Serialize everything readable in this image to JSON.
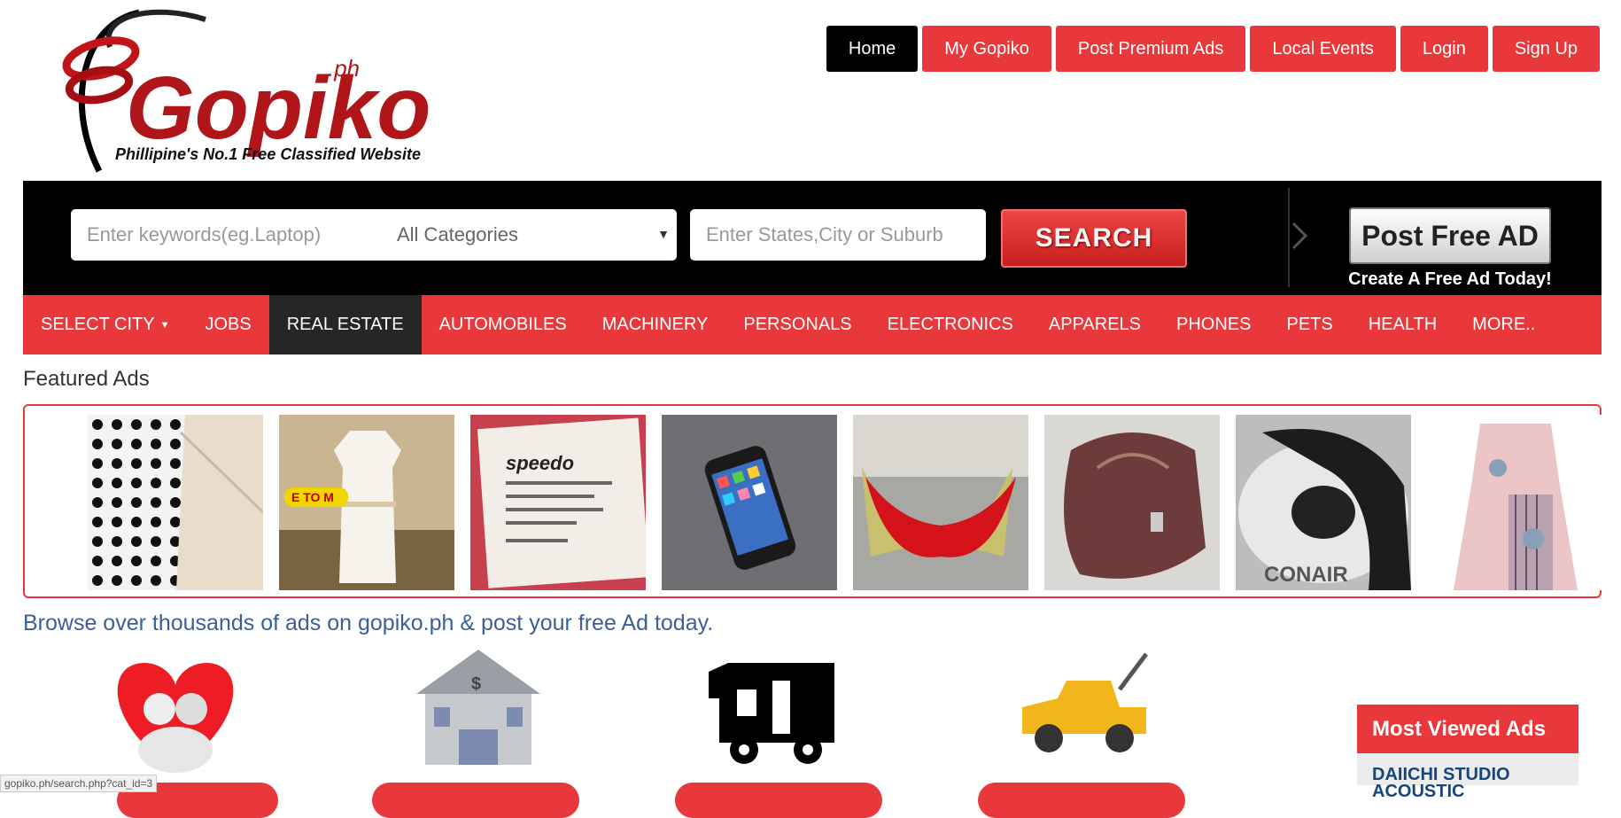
{
  "logo": {
    "brand": "Gopiko",
    "suffix": ".ph",
    "tagline": "Phillipine's No.1  Free Classified Website"
  },
  "top_nav": [
    {
      "label": "Home",
      "active": true
    },
    {
      "label": "My Gopiko"
    },
    {
      "label": "Post Premium Ads"
    },
    {
      "label": "Local Events"
    },
    {
      "label": "Login"
    },
    {
      "label": "Sign Up"
    }
  ],
  "search": {
    "keywords_placeholder": "Enter keywords(eg.Laptop)",
    "category_value": "All Categories",
    "location_placeholder": "Enter States,City or Suburb",
    "button_label": "SEARCH"
  },
  "post_free": {
    "button_label": "Post Free AD",
    "sub_label": "Create A Free Ad Today!"
  },
  "categories": [
    {
      "label": "SELECT CITY"
    },
    {
      "label": "JOBS"
    },
    {
      "label": "REAL ESTATE",
      "active": true
    },
    {
      "label": "AUTOMOBILES"
    },
    {
      "label": "MACHINERY"
    },
    {
      "label": "PERSONALS"
    },
    {
      "label": "ELECTRONICS"
    },
    {
      "label": "APPARELS"
    },
    {
      "label": "PHONES"
    },
    {
      "label": "PETS"
    },
    {
      "label": "HEALTH"
    },
    {
      "label": "MORE.."
    }
  ],
  "featured": {
    "title": "Featured Ads",
    "items": [
      {
        "name": "polka-dot-fabric"
      },
      {
        "name": "white-dress",
        "label": "E TO M"
      },
      {
        "name": "speedo-swimsuit-tag",
        "brand": "speedo"
      },
      {
        "name": "smartphone"
      },
      {
        "name": "red-high-heels"
      },
      {
        "name": "leather-handbag"
      },
      {
        "name": "conair-appliance",
        "brand": "CONAIR"
      },
      {
        "name": "floral-dress"
      }
    ]
  },
  "browse_text": "Browse over thousands of ads on gopiko.ph & post your free Ad today.",
  "category_icons": [
    "personals-heart-icon",
    "real-estate-bank-icon",
    "rv-vehicle-icon",
    "tow-truck-icon"
  ],
  "most_viewed": {
    "title": "Most Viewed Ads",
    "first_item": "DAIICHI STUDIO ACOUSTIC"
  },
  "status_url": "gopiko.ph/search.php?cat_id=3",
  "colors": {
    "accent": "#e8383b",
    "dark": "#000000",
    "link": "#3b5f96"
  }
}
